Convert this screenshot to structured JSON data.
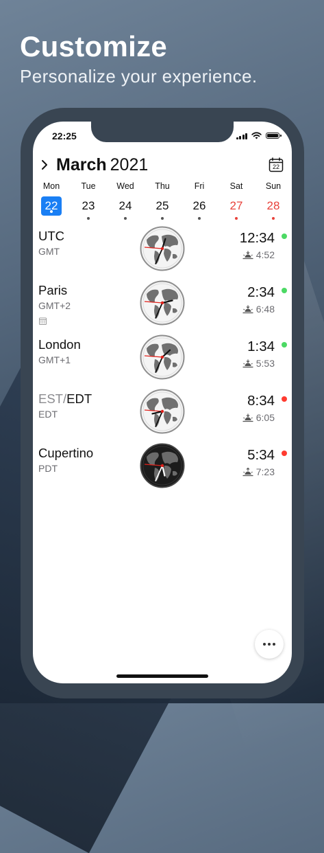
{
  "headline": "Customize",
  "subheadline": "Personalize your experience.",
  "status": {
    "time": "22:25"
  },
  "header": {
    "month": "March",
    "year": "2021",
    "calendar_icon_day": "22"
  },
  "days": [
    {
      "dow": "Mon",
      "num": "22",
      "selected": true,
      "weekend": false
    },
    {
      "dow": "Tue",
      "num": "23",
      "selected": false,
      "weekend": false
    },
    {
      "dow": "Wed",
      "num": "24",
      "selected": false,
      "weekend": false
    },
    {
      "dow": "Thu",
      "num": "25",
      "selected": false,
      "weekend": false
    },
    {
      "dow": "Fri",
      "num": "26",
      "selected": false,
      "weekend": false
    },
    {
      "dow": "Sat",
      "num": "27",
      "selected": false,
      "weekend": true
    },
    {
      "dow": "Sun",
      "num": "28",
      "selected": false,
      "weekend": true
    }
  ],
  "clocks": [
    {
      "city": "UTC",
      "city_dim": "",
      "zone": "GMT",
      "time": "12:34",
      "sun_time": "4:52",
      "sun_icon": "sunset-icon",
      "status": "green",
      "hour": 12,
      "minute": 34,
      "dark": false,
      "calendar": false
    },
    {
      "city": "Paris",
      "city_dim": "",
      "zone": "GMT+2",
      "time": "2:34",
      "sun_time": "6:48",
      "sun_icon": "sunset-icon",
      "status": "green",
      "hour": 2,
      "minute": 34,
      "dark": false,
      "calendar": true
    },
    {
      "city": "London",
      "city_dim": "",
      "zone": "GMT+1",
      "time": "1:34",
      "sun_time": "5:53",
      "sun_icon": "sunset-icon",
      "status": "green",
      "hour": 1,
      "minute": 34,
      "dark": false,
      "calendar": false
    },
    {
      "city": "EDT",
      "city_dim": "EST/",
      "zone": "EDT",
      "time": "8:34",
      "sun_time": "6:05",
      "sun_icon": "sunset-icon",
      "status": "red",
      "hour": 8,
      "minute": 34,
      "dark": false,
      "calendar": false
    },
    {
      "city": "Cupertino",
      "city_dim": "",
      "zone": "PDT",
      "time": "5:34",
      "sun_time": "7:23",
      "sun_icon": "sunrise-icon",
      "status": "red",
      "hour": 5,
      "minute": 34,
      "dark": true,
      "calendar": false
    }
  ],
  "colors": {
    "accent": "#1a7ff4",
    "weekend": "#e8413a",
    "status_green": "#4cd964",
    "status_red": "#ff3b30"
  }
}
